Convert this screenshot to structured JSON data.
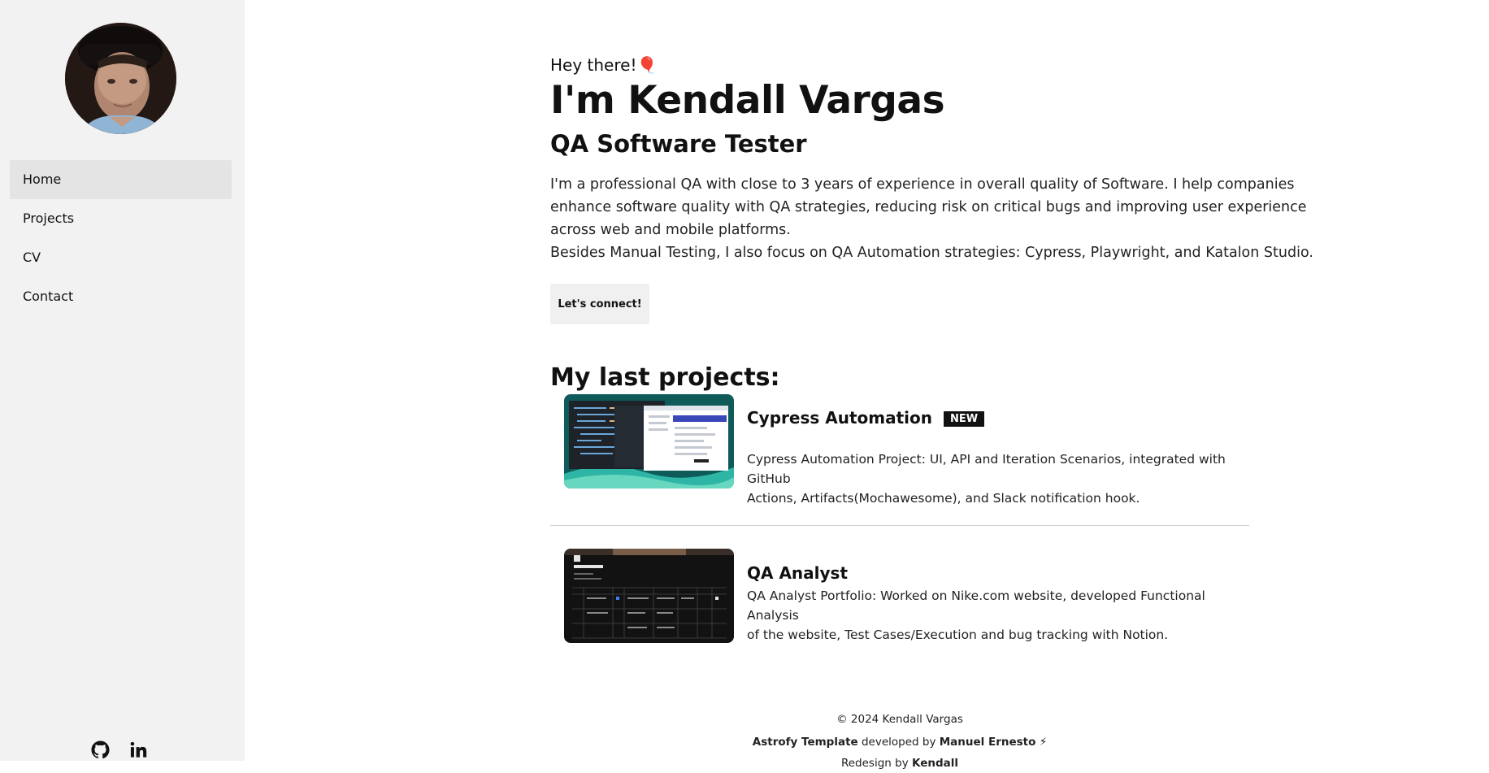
{
  "sidebar": {
    "avatar_alt": "Kendall Vargas",
    "nav": [
      {
        "label": "Home",
        "active": true
      },
      {
        "label": "Projects",
        "active": false
      },
      {
        "label": "CV",
        "active": false
      },
      {
        "label": "Contact",
        "active": false
      }
    ],
    "social": [
      {
        "icon": "github-icon"
      },
      {
        "icon": "linkedin-icon"
      }
    ]
  },
  "hero": {
    "greeting": "Hey there!🎈",
    "name": "I'm Kendall Vargas",
    "role": "QA Software Tester",
    "bio_lines": [
      "I'm a professional QA with close to 3 years of experience in overall quality of Software. I help companies",
      "enhance software quality with QA strategies, reducing risk on critical bugs and improving user experience",
      "across web and mobile platforms.",
      "Besides Manual Testing, I also focus on QA Automation strategies: Cypress, Playwright, and Katalon Studio."
    ],
    "cta_label": "Let's connect!"
  },
  "projects": {
    "heading": "My last projects:",
    "items": [
      {
        "title": "Cypress Automation",
        "badge": "NEW",
        "desc_lines": [
          "Cypress Automation Project: UI, API and Iteration Scenarios, integrated with GitHub",
          "Actions, Artifacts(Mochawesome), and Slack notification hook."
        ]
      },
      {
        "title": "QA Analyst",
        "badge": "",
        "desc_lines": [
          "QA Analyst Portfolio: Worked on Nike.com website, developed Functional Analysis",
          "of the website, Test Cases/Execution and bug tracking with Notion."
        ]
      }
    ]
  },
  "footer": {
    "copyright": "© 2024 Kendall Vargas",
    "template_name": "Astrofy Template",
    "developed_by": " developed by ",
    "developer": "Manuel Ernesto",
    "bolt": " ⚡",
    "redesign_prefix": "Redesign by ",
    "redesigner": "Kendall"
  },
  "colors": {
    "sidebar_bg": "#f2f2f2",
    "nav_active_bg": "#e4e4e4",
    "badge_bg": "#111111",
    "cta_bg": "#f0f0f0"
  }
}
